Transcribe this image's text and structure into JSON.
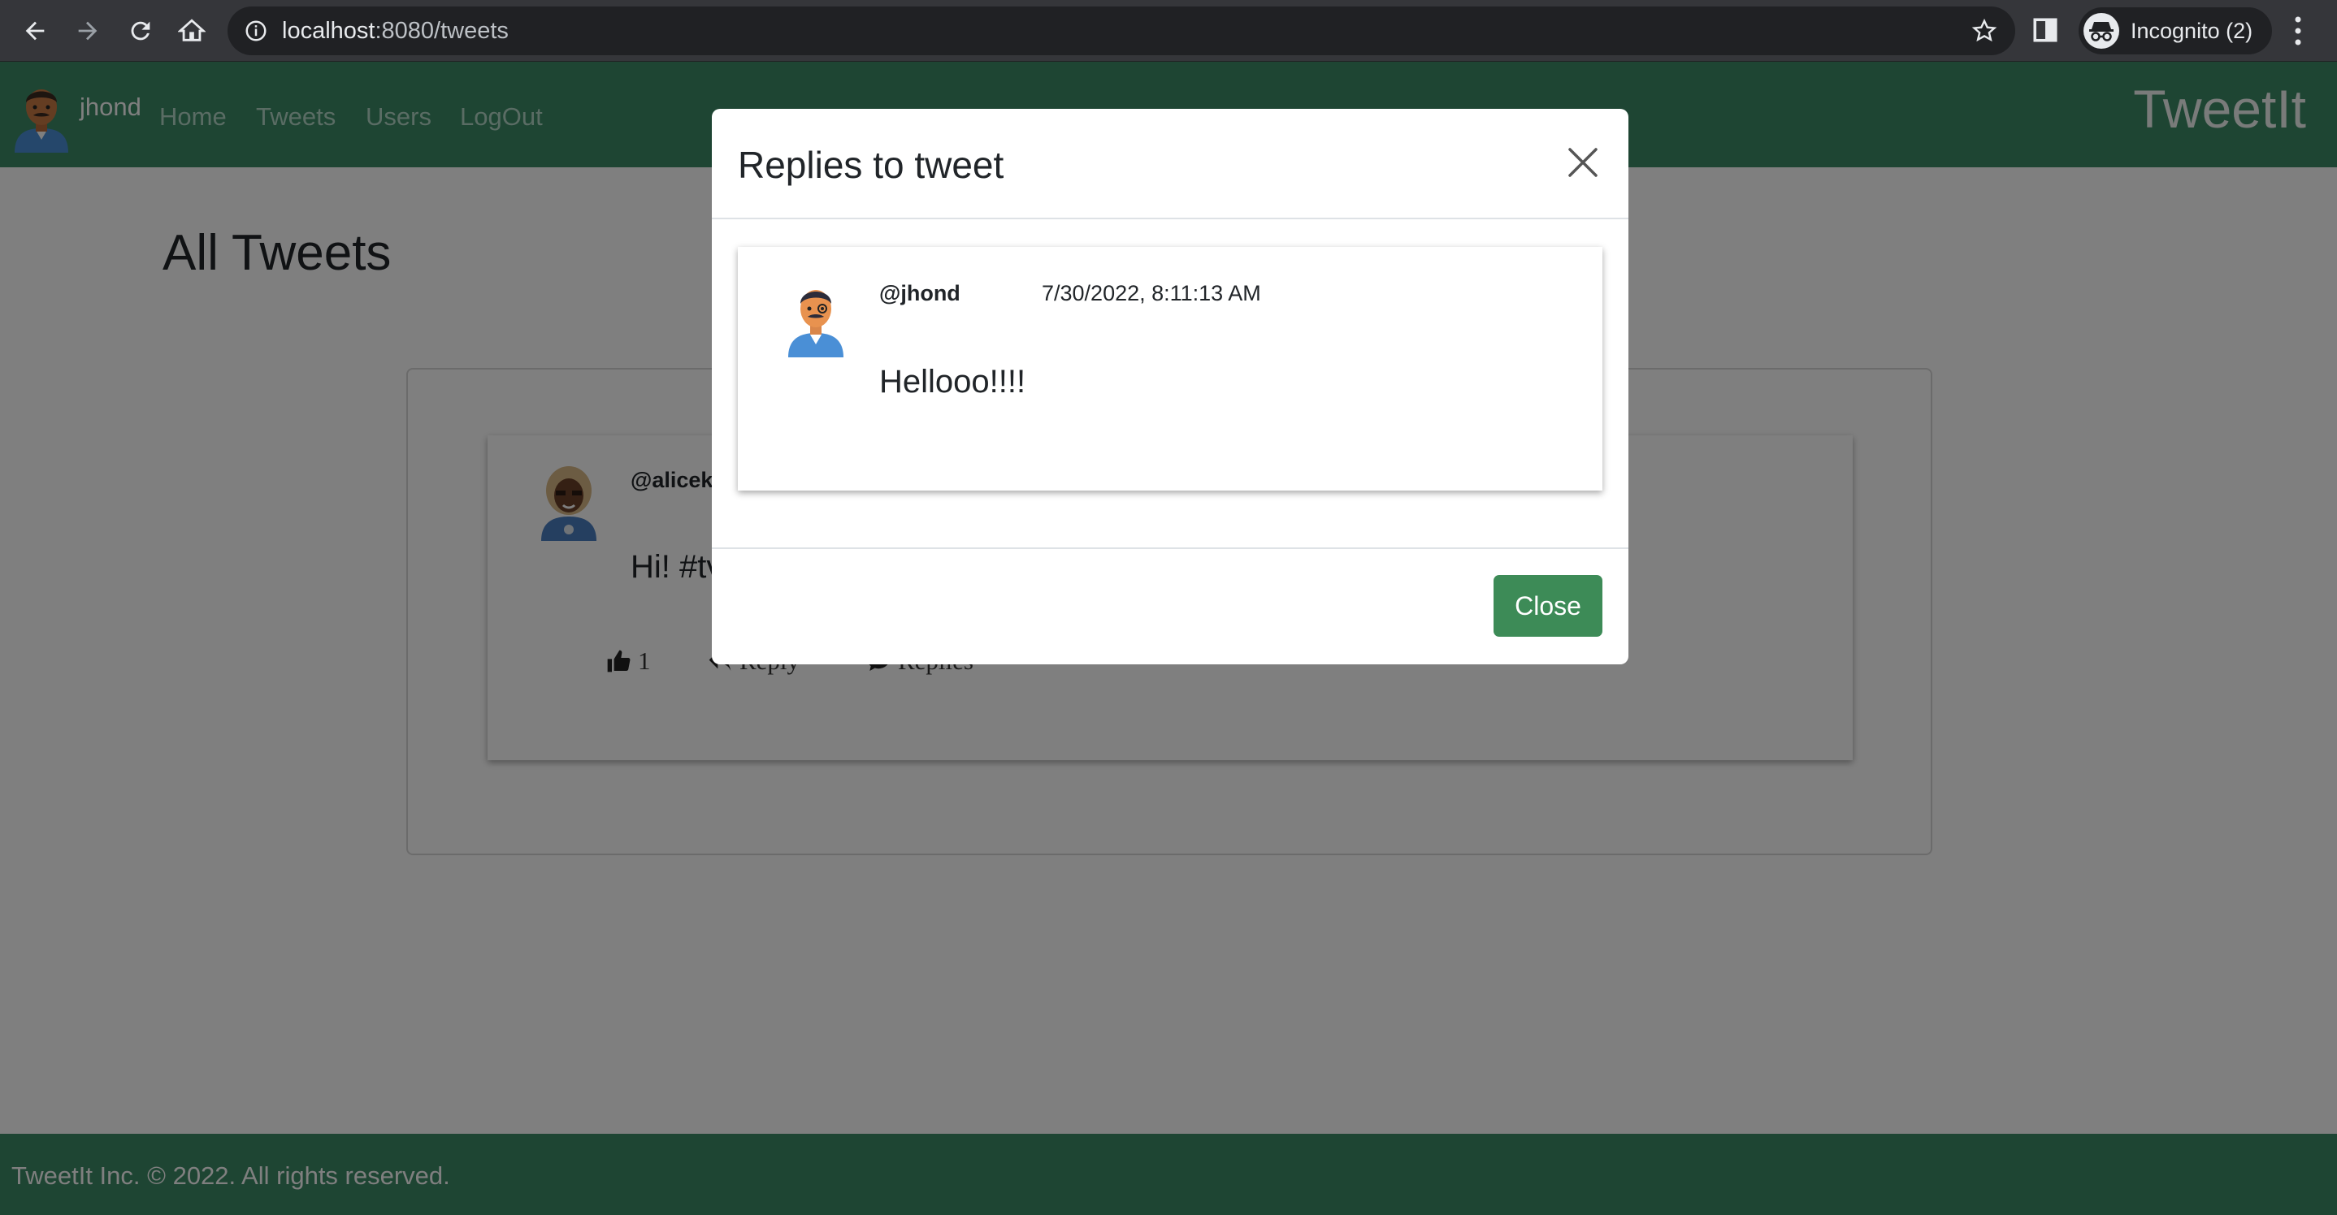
{
  "browser": {
    "url_host": "localhost",
    "url_path": ":8080/tweets",
    "profile_label": "Incognito (2)",
    "icons": [
      "back-arrow-icon",
      "forward-arrow-icon",
      "reload-icon",
      "home-icon",
      "info-icon",
      "star-icon",
      "side-panel-icon",
      "incognito-icon",
      "kebab-menu-icon"
    ]
  },
  "navbar": {
    "username": "jhond",
    "links": [
      "Home",
      "Tweets",
      "Users",
      "LogOut"
    ],
    "brand": "TweetIt",
    "color": "#3d8b67"
  },
  "main": {
    "title": "All Tweets",
    "tweet": {
      "handle": "@alicek",
      "text": "Hi! #tv",
      "likes": "1",
      "reply_label": "Reply",
      "replies_label": "Replies"
    }
  },
  "footer": {
    "text": "TweetIt Inc. © 2022. All rights reserved."
  },
  "modal": {
    "title": "Replies to tweet",
    "reply": {
      "handle": "@jhond",
      "timestamp": "7/30/2022, 8:11:13 AM",
      "text": "Hellooo!!!!"
    },
    "close_label": "Close",
    "button_color": "#3d8b57"
  }
}
